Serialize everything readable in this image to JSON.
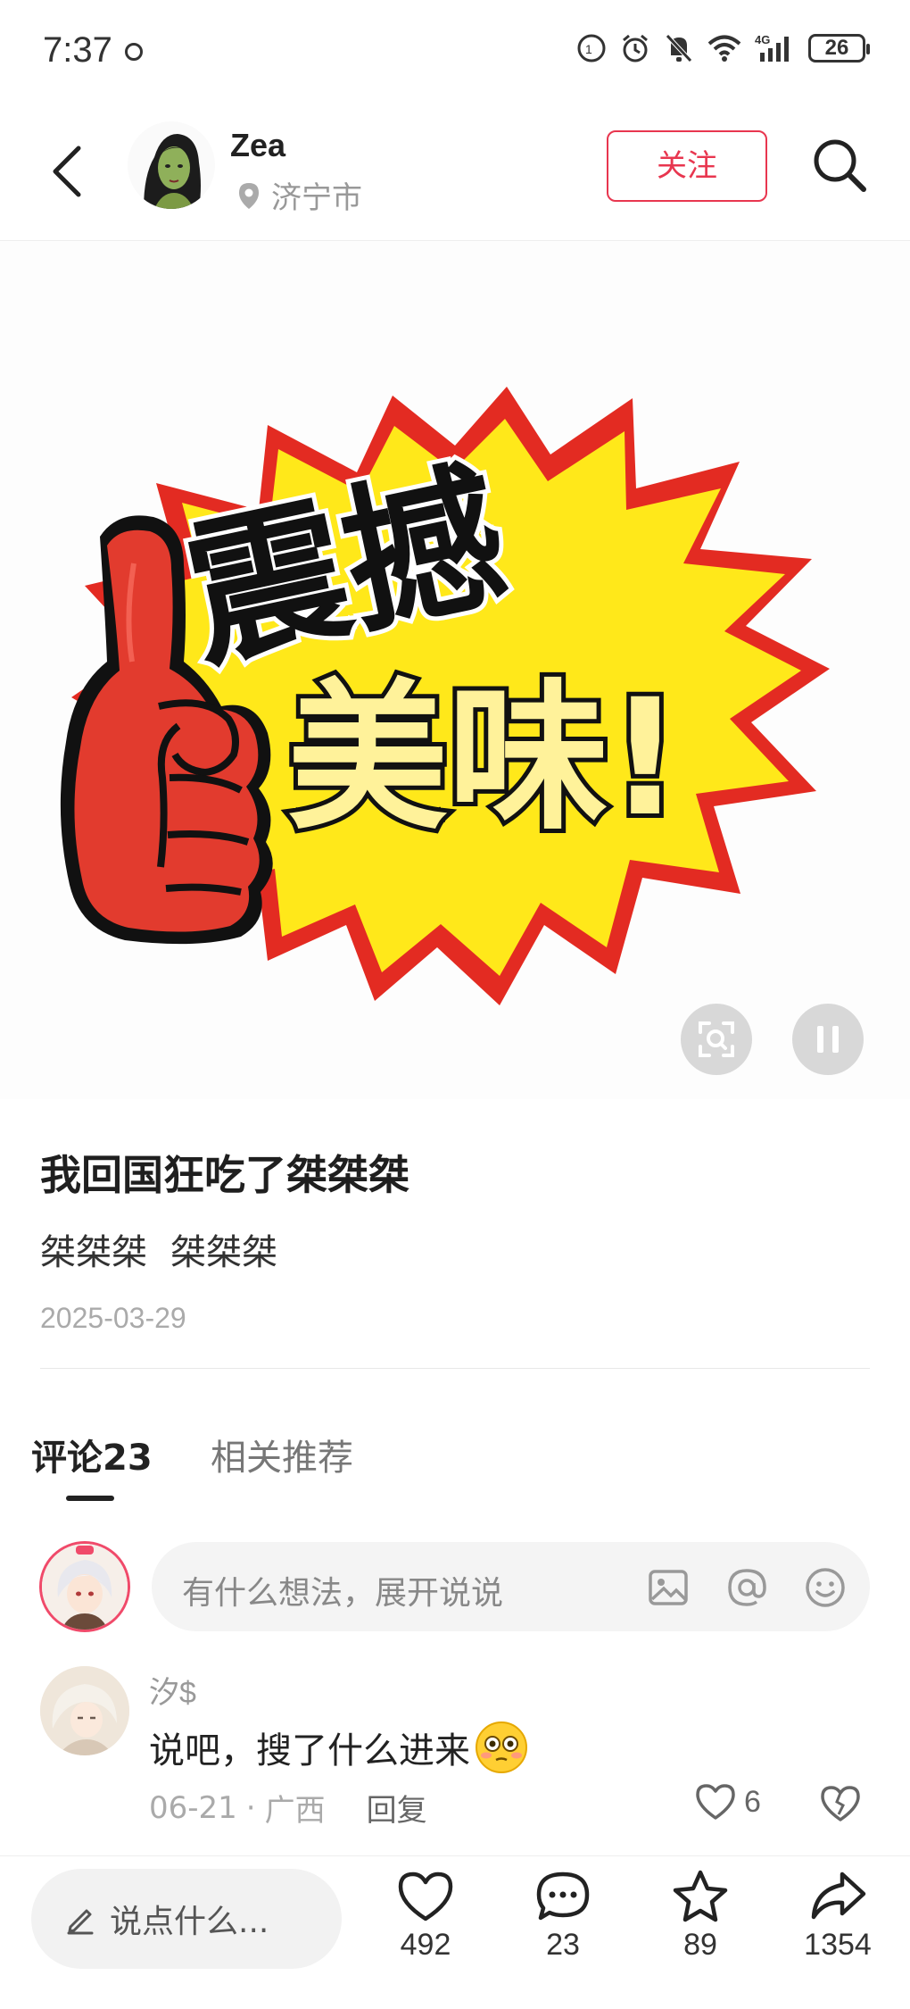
{
  "status_bar": {
    "time": "7:37",
    "network": "4G",
    "battery": "26"
  },
  "header": {
    "author_name": "Zea",
    "location": "济宁市",
    "follow_label": "关注"
  },
  "hero": {
    "line1": "震撼",
    "line2": "美味!"
  },
  "post": {
    "title": "我回国狂吃了桀桀桀",
    "tags": [
      "桀桀桀",
      "桀桀桀"
    ],
    "date": "2025-03-29"
  },
  "tabs": {
    "comments": "评论23",
    "related": "相关推荐"
  },
  "comment_input": {
    "placeholder": "有什么想法，展开说说"
  },
  "comments": [
    {
      "user": "汐$",
      "text": "说吧，搜了什么进来",
      "date": "06-21",
      "region": "广西",
      "reply_label": "回复",
      "likes": "6"
    }
  ],
  "bottom_bar": {
    "say_placeholder": "说点什么...",
    "likes": "492",
    "comments": "23",
    "favorites": "89",
    "shares": "1354"
  },
  "colors": {
    "accent": "#e8364f",
    "starburst": "#ffe81a",
    "thumb": "#e23b2e"
  }
}
